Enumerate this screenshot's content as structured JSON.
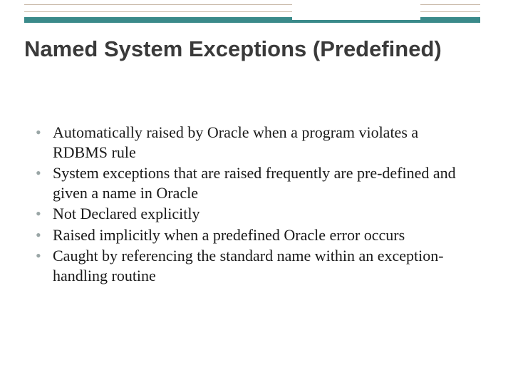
{
  "title": "Named System Exceptions (Predefined)",
  "bullets": [
    "Automatically raised by Oracle when a program violates a RDBMS rule",
    "System exceptions that are raised frequently are pre-defined and given a name in Oracle",
    "Not Declared explicitly",
    "Raised implicitly when a predefined Oracle error occurs",
    "Caught by referencing the standard name within an exception-handling routine"
  ]
}
